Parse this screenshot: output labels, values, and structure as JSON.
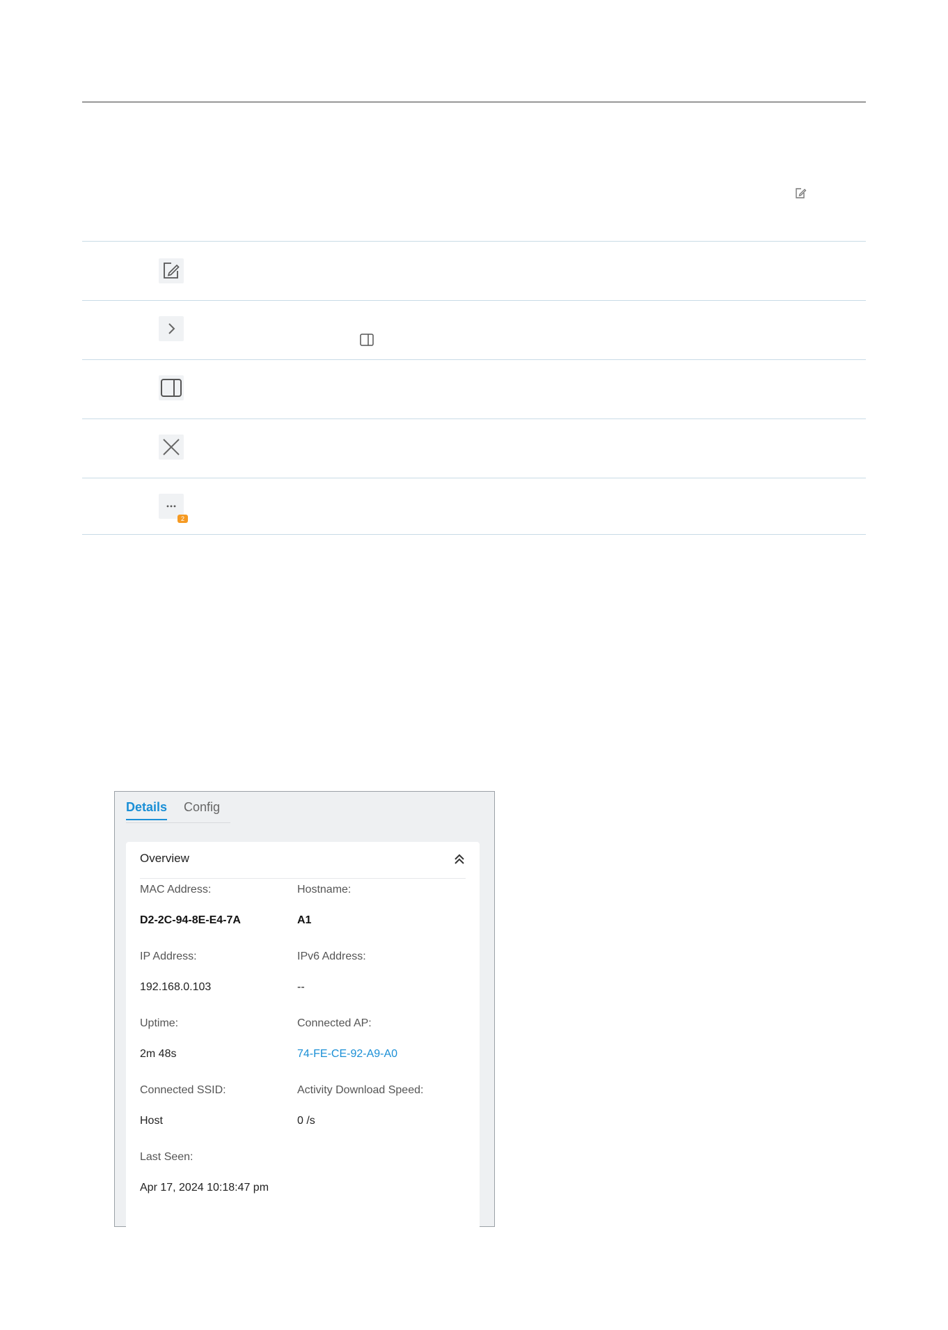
{
  "icons": [
    {
      "name": "edit-icon"
    },
    {
      "name": "chevron-right-icon"
    },
    {
      "name": "panel-icon"
    },
    {
      "name": "close-icon"
    },
    {
      "name": "more-icon",
      "badge": "2"
    }
  ],
  "panel": {
    "tabs": [
      "Details",
      "Config"
    ],
    "active_tab": "Details",
    "overview": {
      "title": "Overview",
      "fields": [
        {
          "label": "MAC Address:",
          "value": "D2-2C-94-8E-E4-7A"
        },
        {
          "label": "Hostname:",
          "value": "A1"
        },
        {
          "label": "IP Address:",
          "value": "192.168.0.103"
        },
        {
          "label": "IPv6 Address:",
          "value": "--"
        },
        {
          "label": "Uptime:",
          "value": "2m 48s"
        },
        {
          "label": "Connected AP:",
          "value": "74-FE-CE-92-A9-A0"
        },
        {
          "label": "Connected SSID:",
          "value": "Host"
        },
        {
          "label": "Activity Download Speed:",
          "value": "0 /s"
        },
        {
          "label": "Last Seen:",
          "value": "Apr 17, 2024 10:18:47 pm"
        }
      ]
    }
  },
  "colors": {
    "accent": "#1a8fd6",
    "badge": "#f59a23"
  }
}
